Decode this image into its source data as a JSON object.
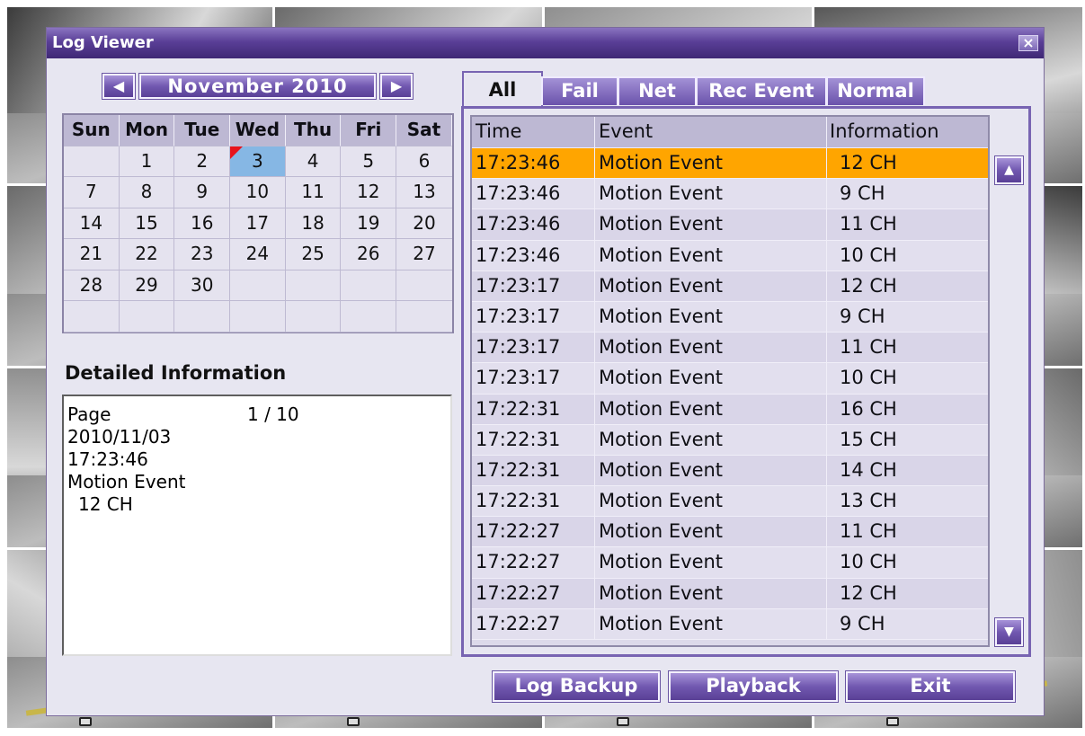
{
  "window": {
    "title": "Log Viewer",
    "close_icon": "close-icon"
  },
  "calendar": {
    "prev_glyph": "◀",
    "next_glyph": "▶",
    "month_label": "November 2010",
    "weekdays": [
      "Sun",
      "Mon",
      "Tue",
      "Wed",
      "Thu",
      "Fri",
      "Sat"
    ],
    "weeks": [
      [
        "",
        "1",
        "2",
        "3",
        "4",
        "5",
        "6"
      ],
      [
        "7",
        "8",
        "9",
        "10",
        "11",
        "12",
        "13"
      ],
      [
        "14",
        "15",
        "16",
        "17",
        "18",
        "19",
        "20"
      ],
      [
        "21",
        "22",
        "23",
        "24",
        "25",
        "26",
        "27"
      ],
      [
        "28",
        "29",
        "30",
        "",
        "",
        "",
        ""
      ],
      [
        "",
        "",
        "",
        "",
        "",
        "",
        ""
      ]
    ],
    "selected_day": "3",
    "selected_color": "#86b7e4",
    "event_marker_color": "#e8141c"
  },
  "detail": {
    "title": "Detailed Information",
    "page_label": "Page",
    "page_value": "1 / 10",
    "date": "2010/11/03",
    "time": "17:23:46",
    "event": "Motion Event",
    "info": "12 CH"
  },
  "tabs": [
    "All",
    "Fail",
    "Net",
    "Rec Event",
    "Normal"
  ],
  "active_tab": "All",
  "log": {
    "columns": [
      "Time",
      "Event",
      "Information"
    ],
    "rows": [
      [
        "17:23:46",
        "Motion Event",
        "12 CH"
      ],
      [
        "17:23:46",
        "Motion Event",
        "9 CH"
      ],
      [
        "17:23:46",
        "Motion Event",
        "11 CH"
      ],
      [
        "17:23:46",
        "Motion Event",
        "10 CH"
      ],
      [
        "17:23:17",
        "Motion Event",
        "12 CH"
      ],
      [
        "17:23:17",
        "Motion Event",
        "9 CH"
      ],
      [
        "17:23:17",
        "Motion Event",
        "11 CH"
      ],
      [
        "17:23:17",
        "Motion Event",
        "10 CH"
      ],
      [
        "17:22:31",
        "Motion Event",
        "16 CH"
      ],
      [
        "17:22:31",
        "Motion Event",
        "15 CH"
      ],
      [
        "17:22:31",
        "Motion Event",
        "14 CH"
      ],
      [
        "17:22:31",
        "Motion Event",
        "13 CH"
      ],
      [
        "17:22:27",
        "Motion Event",
        "11 CH"
      ],
      [
        "17:22:27",
        "Motion Event",
        "10 CH"
      ],
      [
        "17:22:27",
        "Motion Event",
        "12 CH"
      ],
      [
        "17:22:27",
        "Motion Event",
        "9 CH"
      ]
    ],
    "selected_row": 0,
    "selected_color": "#ffa500",
    "scroll_up_icon": "▲",
    "scroll_down_icon": "▼"
  },
  "buttons": {
    "log_backup": "Log Backup",
    "playback": "Playback",
    "exit": "Exit"
  },
  "colors": {
    "title_bar": "#5a3f97",
    "button": "#7158b0",
    "dialog_bg": "#e7e6f1"
  }
}
